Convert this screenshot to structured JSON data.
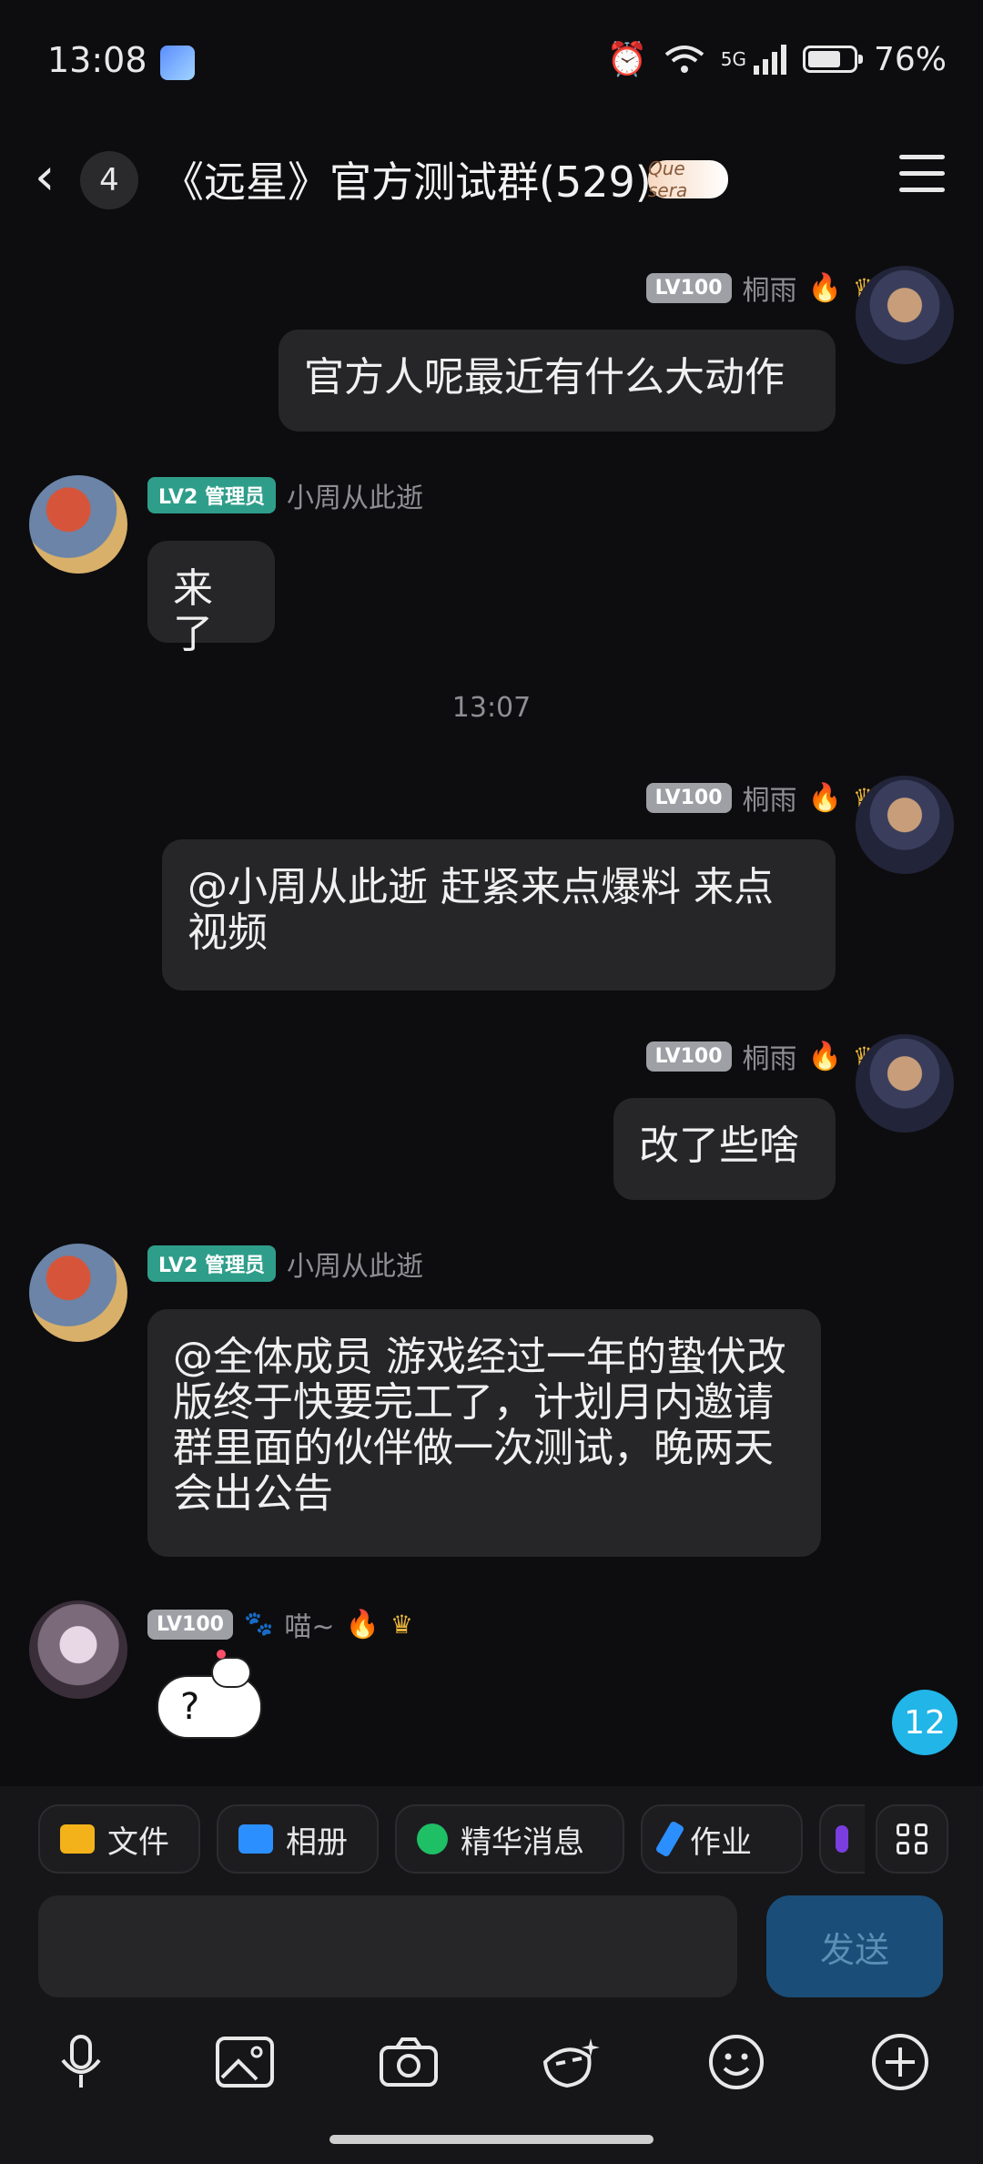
{
  "status": {
    "time": "13:08",
    "network": "5G",
    "battery": "76%",
    "battery_level": 0.76
  },
  "header": {
    "unread_count": "4",
    "title": "《远星》官方测试群(529)",
    "badge_text": "Que sera"
  },
  "messages": [
    {
      "sender": "桐雨",
      "level": "LV100",
      "text": "官方人呢最近有什么大动作"
    },
    {
      "sender": "小周从此逝",
      "level": "LV2 管理员",
      "text": "来了"
    },
    {
      "sender": "桐雨",
      "level": "LV100",
      "text": "@小周从此逝 赶紧来点爆料 来点视频"
    },
    {
      "sender": "桐雨",
      "level": "LV100",
      "text": "改了些啥"
    },
    {
      "sender": "小周从此逝",
      "level": "LV2 管理员",
      "text": "@全体成员 游戏经过一年的蛰伏改版终于快要完工了，计划月内邀请群里面的伙伴做一次测试，晚两天会出公告"
    },
    {
      "sender": "喵~",
      "level": "LV100",
      "sticker": "?"
    }
  ],
  "timestamp": "13:07",
  "new_message_count": "12",
  "quick_actions": {
    "file": "文件",
    "album": "相册",
    "essence": "精华消息",
    "homework": "作业"
  },
  "input": {
    "send_label": "发送"
  }
}
